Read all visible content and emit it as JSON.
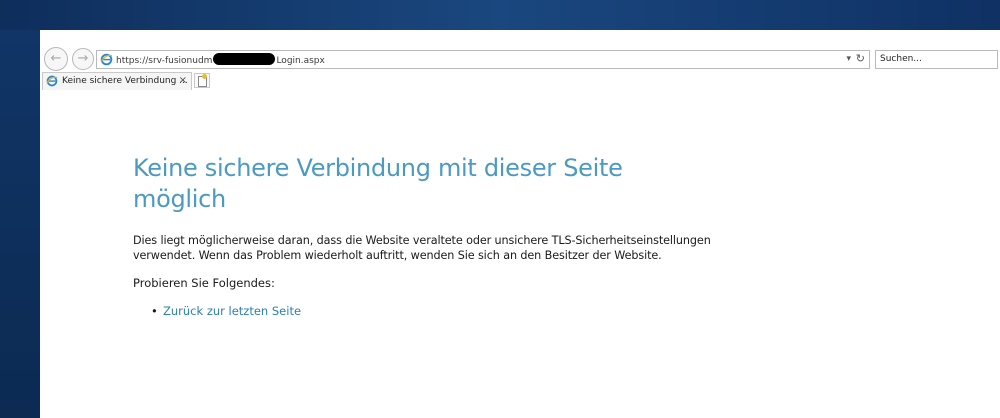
{
  "browser": {
    "address": {
      "url_prefix": "https://srv-fusionudm",
      "url_suffix": "Login.aspx",
      "dropdown_glyph": "▾",
      "refresh_glyph": "↻"
    },
    "search": {
      "placeholder": "Suchen..."
    },
    "tabs": [
      {
        "title": "Keine sichere Verbindung ...",
        "close_glyph": "×"
      }
    ],
    "nav": {
      "back_glyph": "←",
      "forward_glyph": "→"
    }
  },
  "page": {
    "title": "Keine sichere Verbindung mit dieser Seite möglich",
    "description": "Dies liegt möglicherweise daran, dass die Website veraltete oder unsichere TLS-Sicherheitseinstellungen verwendet. Wenn das Problem wiederholt auftritt, wenden Sie sich an den Besitzer der Website.",
    "try_heading": "Probieren Sie Folgendes:",
    "suggestions": [
      {
        "label": "Zurück zur letzten Seite"
      }
    ],
    "title_color": "#4a9ac2",
    "link_color": "#2a7fb0"
  },
  "icons": {
    "address_icon": "ie-icon",
    "tab_icon": "ie-icon",
    "new_tab": "new-tab-icon"
  }
}
